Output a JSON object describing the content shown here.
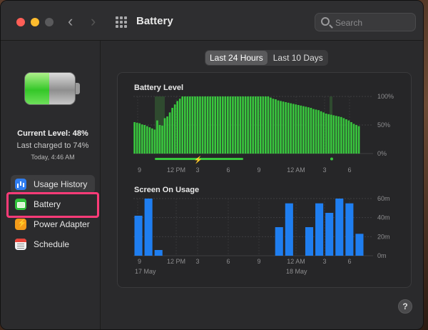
{
  "window": {
    "title": "Battery",
    "back_glyph": "‹",
    "forward_glyph": "›",
    "search_placeholder": "Search"
  },
  "sidebar": {
    "current_level_label": "Current Level: 48%",
    "battery_fill_fraction": 0.48,
    "last_charged": "Last charged to 74%",
    "today_time": "Today, 4:46 AM",
    "items": [
      {
        "label": "Usage History",
        "icon": "bar-chart-icon",
        "selected": true
      },
      {
        "label": "Battery",
        "icon": "battery-icon",
        "selected": false
      },
      {
        "label": "Power Adapter",
        "icon": "power-adapter-icon",
        "selected": false
      },
      {
        "label": "Schedule",
        "icon": "calendar-icon",
        "selected": false
      }
    ],
    "highlight_color": "#ff3b78"
  },
  "segmented": {
    "options": [
      "Last 24 Hours",
      "Last 10 Days"
    ],
    "selected_index": 0
  },
  "help_label": "?",
  "chart_data": [
    {
      "type": "bar",
      "title": "Battery Level",
      "y_ticks": [
        "100%",
        "50%",
        "0%"
      ],
      "ylim": [
        0,
        100
      ],
      "x_ticks": [
        "9",
        "12 PM",
        "3",
        "6",
        "9",
        "12 AM",
        "3",
        "6"
      ],
      "bar_color": "#39c73e",
      "values": [
        55,
        54,
        53,
        51,
        50,
        48,
        46,
        44,
        42,
        58,
        50,
        49,
        62,
        65,
        72,
        80,
        86,
        92,
        96,
        100,
        100,
        100,
        100,
        100,
        100,
        100,
        100,
        100,
        100,
        100,
        100,
        100,
        100,
        100,
        100,
        100,
        100,
        100,
        100,
        100,
        100,
        100,
        100,
        100,
        100,
        100,
        100,
        100,
        100,
        100,
        100,
        100,
        100,
        100,
        98,
        96,
        95,
        93,
        92,
        91,
        90,
        89,
        88,
        87,
        86,
        85,
        84,
        83,
        82,
        81,
        80,
        78,
        77,
        76,
        74,
        72,
        70,
        69,
        68,
        67,
        66,
        65,
        64,
        62,
        60,
        58,
        55,
        52,
        50,
        48
      ],
      "charging_indicator": "⚡"
    },
    {
      "type": "bar",
      "title": "Screen On Usage",
      "y_ticks": [
        "60m",
        "40m",
        "20m",
        "0m"
      ],
      "ylim": [
        0,
        60
      ],
      "x_ticks": [
        "9",
        "12 PM",
        "3",
        "6",
        "9",
        "12 AM",
        "3",
        "6"
      ],
      "date_labels": [
        "17 May",
        "18 May"
      ],
      "bar_color": "#1f7ef0",
      "values": [
        42,
        60,
        6,
        0,
        0,
        0,
        0,
        0,
        0,
        0,
        0,
        0,
        0,
        0,
        30,
        55,
        0,
        30,
        55,
        45,
        60,
        55,
        23
      ]
    }
  ]
}
